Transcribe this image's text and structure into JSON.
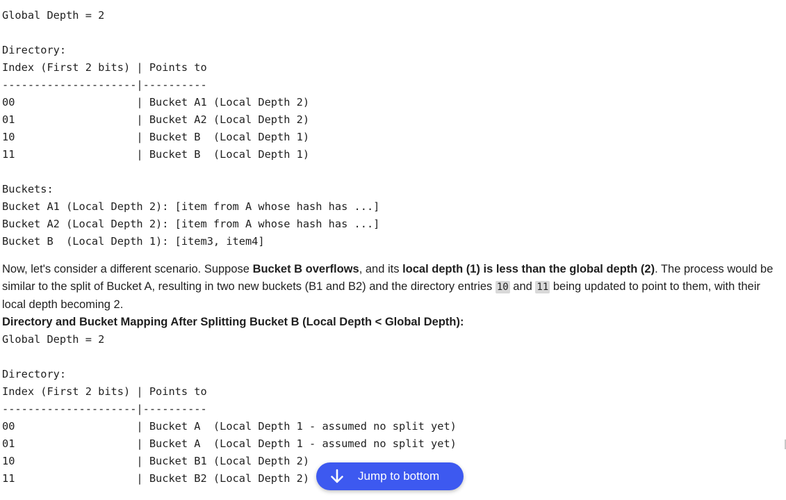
{
  "code_block_1": {
    "lines": [
      "Global Depth = 2",
      "",
      "Directory:",
      "Index (First 2 bits) | Points to",
      "---------------------|----------",
      "00                   | Bucket A1 (Local Depth 2)",
      "01                   | Bucket A2 (Local Depth 2)",
      "10                   | Bucket B  (Local Depth 1)",
      "11                   | Bucket B  (Local Depth 1)",
      "",
      "Buckets:",
      "Bucket A1 (Local Depth 2): [item from A whose hash has ...]",
      "Bucket A2 (Local Depth 2): [item from A whose hash has ...]",
      "Bucket B  (Local Depth 1): [item3, item4]"
    ]
  },
  "paragraph": {
    "part1": "Now, let's consider a different scenario. Suppose ",
    "bold1": "Bucket B overflows",
    "part2": ", and its ",
    "bold2": "local depth (1) is less than the global depth (2)",
    "part3": ". The process would be similar to the split of Bucket A, resulting in two new buckets (B1 and B2) and the directory entries ",
    "code1": "10",
    "part4": " and ",
    "code2": "11",
    "part5": " being updated to point to them, with their local depth becoming 2."
  },
  "heading": "Directory and Bucket Mapping After Splitting Bucket B (Local Depth < Global Depth):",
  "code_block_2": {
    "lines": [
      "Global Depth = 2",
      "",
      "Directory:",
      "Index (First 2 bits) | Points to",
      "---------------------|----------",
      "00                   | Bucket A  (Local Depth 1 - assumed no split yet)",
      "01                   | Bucket A  (Local Depth 1 - assumed no split yet)",
      "10                   | Bucket B1 (Local Depth 2)",
      "11                   | Bucket B2 (Local Depth 2)"
    ]
  },
  "jump_button": {
    "label": "Jump to bottom",
    "icon": "arrow-down-icon",
    "color": "#3d59f0"
  }
}
